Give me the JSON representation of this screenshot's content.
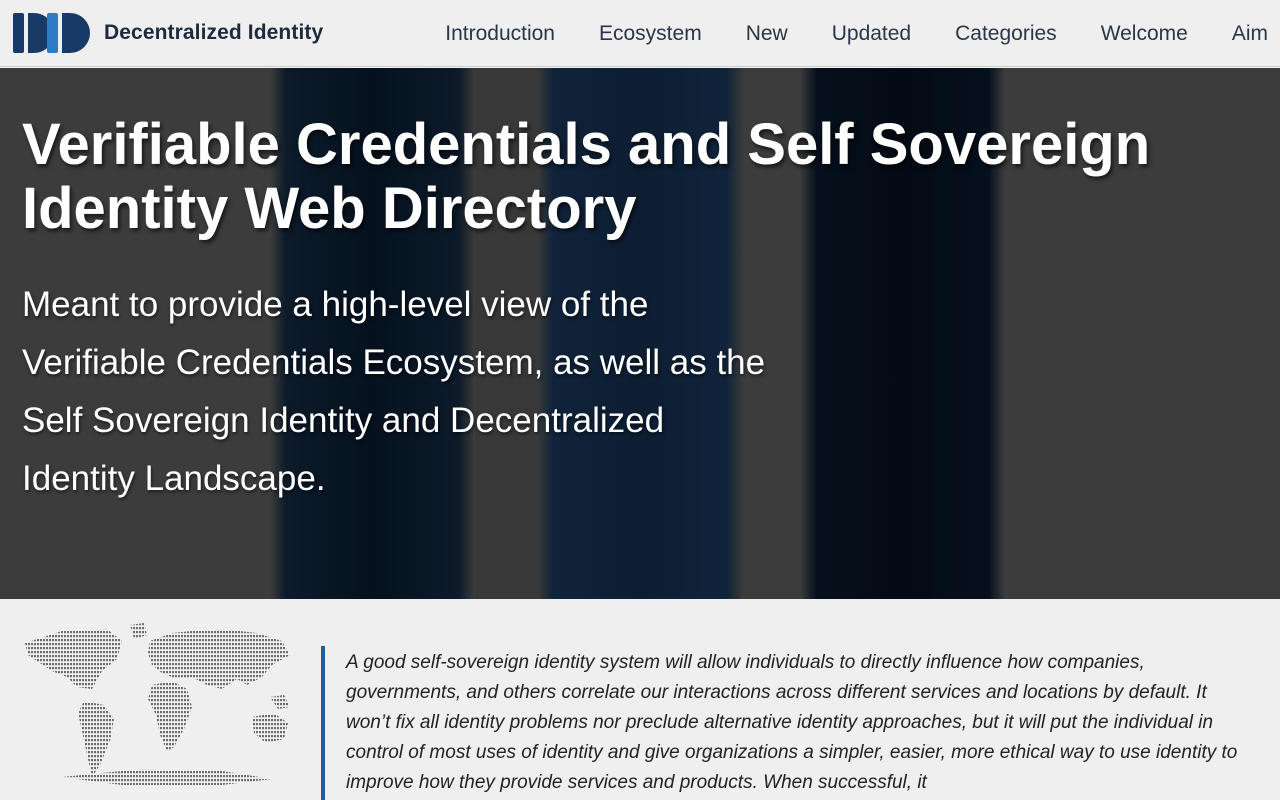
{
  "header": {
    "brand": "Decentralized Identity",
    "nav": [
      "Introduction",
      "Ecosystem",
      "New",
      "Updated",
      "Categories",
      "Welcome",
      "Aim"
    ]
  },
  "hero": {
    "title": "Verifiable Credentials and Self Sovereign Identity Web Directory",
    "subtitle": "Meant to provide a high-level view of the Verifiable Credentials Ecosystem, as well as the Self Sovereign Identity and Decentralized Identity Landscape."
  },
  "content": {
    "quote": "A good self-sovereign identity system will allow individuals to directly influence how companies, governments, and others correlate our interactions across different services and locations by default. It won’t fix all identity problems nor preclude alternative identity approaches, but it will put the individual in control of most uses of identity and give organizations a simpler, easier, more ethical way to use identity to improve how they provide services and products. When successful, it"
  },
  "colors": {
    "accent": "#1d5fa3",
    "logo_dark": "#173a66",
    "logo_light": "#2f7cc4"
  },
  "icons": {
    "logo": "did-logo",
    "map": "world-map-icon"
  }
}
